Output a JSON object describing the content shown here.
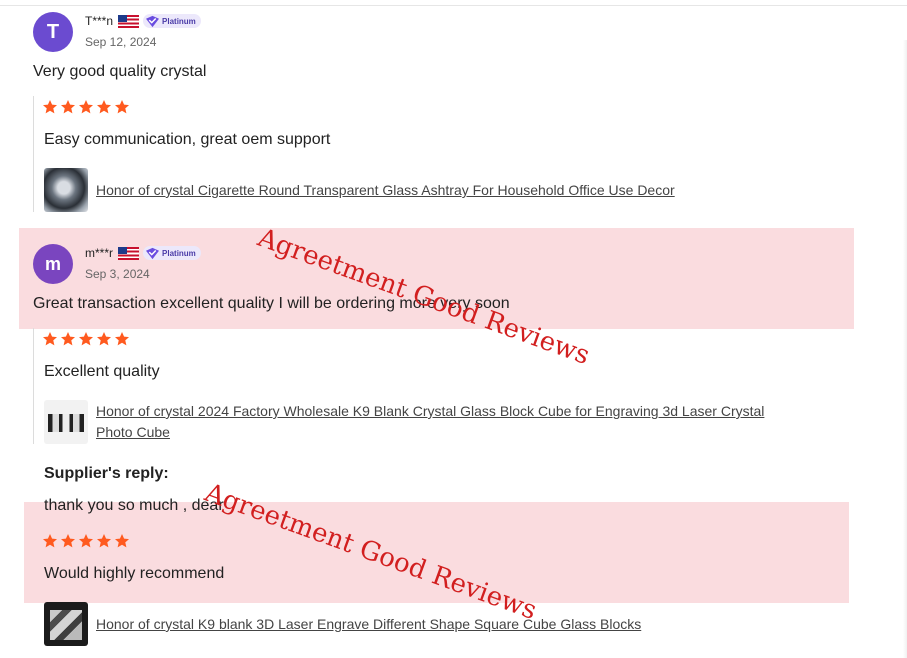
{
  "reviews": [
    {
      "avatar_letter": "T",
      "username": "T***n",
      "badge": "Platinum",
      "date": "Sep 12, 2024",
      "overall_comment": "Very good quality crystal",
      "rating": 5,
      "detail": "Easy communication, great oem support",
      "product": "Honor of crystal Cigarette Round Transparent Glass Ashtray For Household Office Use Decor"
    },
    {
      "avatar_letter": "m",
      "username": "m***r",
      "badge": "Platinum",
      "date": "Sep 3, 2024",
      "overall_comment": "Great transaction excellent quality I will be ordering more very soon",
      "rating": 5,
      "detail": "Excellent quality",
      "product_line1": "Honor of crystal 2024 Factory Wholesale K9 Blank Crystal Glass Block Cube for Engraving 3d Laser Crystal",
      "product_line2": "Photo Cube",
      "supplier_reply_label": "Supplier's reply:",
      "supplier_reply": "thank you so much , dear"
    },
    {
      "rating": 5,
      "detail": "Would highly recommend",
      "product": "Honor of crystal K9 blank 3D Laser Engrave Different Shape Square Cube Glass Blocks"
    }
  ],
  "watermark": "Agreetment Good Reviews",
  "colors": {
    "star": "#ff5a1f",
    "highlight": "#fadcdf",
    "watermark": "#d21f1f",
    "avatar": "#6b4bd0",
    "badge": "#ece8fb"
  },
  "icons": [
    "us-flag-icon",
    "verified-badge-icon",
    "star-icon"
  ]
}
